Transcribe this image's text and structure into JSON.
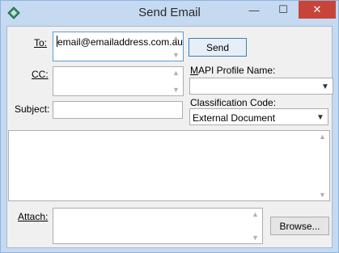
{
  "window": {
    "title": "Send Email",
    "controls": {
      "minimize": "—",
      "maximize": "☐",
      "close": "✕"
    }
  },
  "form": {
    "to_label": "To:",
    "to_value": "email@emailaddress.com.au",
    "cc_label": "CC:",
    "cc_value": "",
    "subject_label": "Subject:",
    "subject_value": "",
    "body_value": "",
    "attach_label": "Attach:",
    "attach_value": ""
  },
  "buttons": {
    "send": "Send",
    "browse": "Browse..."
  },
  "mapi": {
    "label": "MAPI Profile Name:",
    "selected": ""
  },
  "classification": {
    "label": "Classification Code:",
    "selected": "External Document"
  },
  "icons": {
    "app": "app-diamond-icon",
    "scroll_up": "scroll-up-arrow-icon",
    "scroll_down": "scroll-down-arrow-icon",
    "dropdown": "chevron-down-icon"
  }
}
